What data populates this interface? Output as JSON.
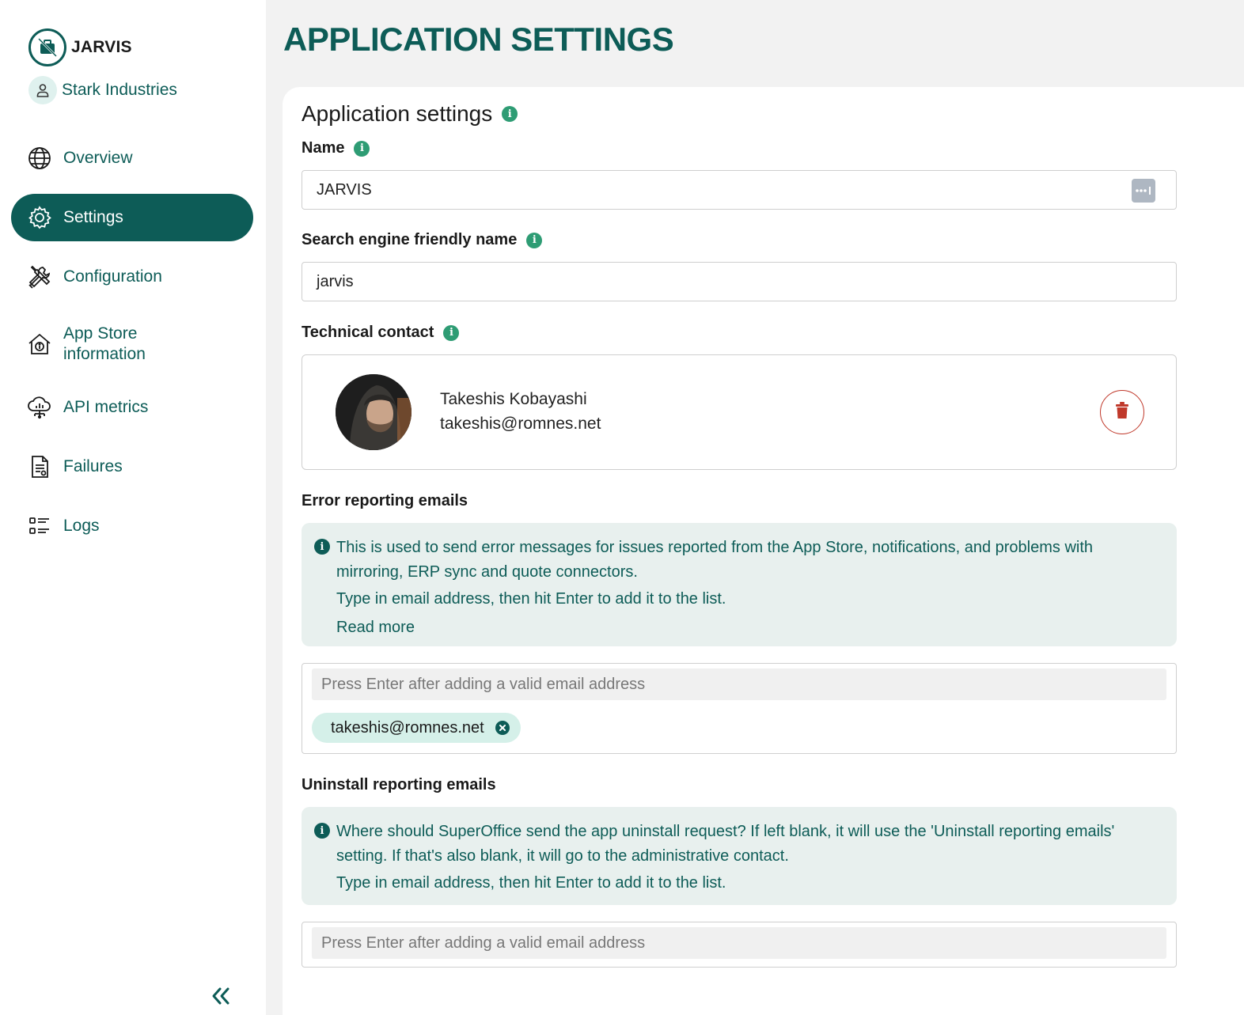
{
  "brand": {
    "name": "JARVIS"
  },
  "tenant": {
    "name": "Stark Industries"
  },
  "nav": {
    "items": [
      {
        "label": "Overview",
        "icon": "globe-icon"
      },
      {
        "label": "Settings",
        "icon": "gear-icon",
        "active": true
      },
      {
        "label": "Configuration",
        "icon": "tools-icon"
      },
      {
        "label": "App Store information",
        "icon": "store-info-icon"
      },
      {
        "label": "API metrics",
        "icon": "cloud-metrics-icon"
      },
      {
        "label": "Failures",
        "icon": "document-icon"
      },
      {
        "label": "Logs",
        "icon": "list-icon"
      }
    ]
  },
  "page": {
    "title": "APPLICATION SETTINGS"
  },
  "settings": {
    "section_title": "Application settings",
    "name": {
      "label": "Name",
      "value": "JARVIS"
    },
    "seo_name": {
      "label": "Search engine friendly name",
      "value": "jarvis"
    },
    "technical_contact": {
      "label": "Technical contact",
      "name": "Takeshis Kobayashi",
      "email": "takeshis@romnes.net"
    },
    "error_emails": {
      "label": "Error reporting emails",
      "info_line1": "This is used to send error messages for issues reported from the App Store, notifications, and problems with mirroring, ERP sync and quote connectors.",
      "info_line2": "Type in email address, then hit Enter to add it to the list.",
      "read_more": "Read more",
      "placeholder": "Press Enter after adding a valid email address",
      "chips": [
        "takeshis@romnes.net"
      ]
    },
    "uninstall_emails": {
      "label": "Uninstall reporting emails",
      "info_line1": "Where should SuperOffice send the app uninstall request? If left blank, it will use the 'Uninstall reporting emails' setting. If that's also blank, it will go to the administrative contact.",
      "info_line2": "Type in email address, then hit Enter to add it to the list.",
      "placeholder": "Press Enter after adding a valid email address"
    }
  },
  "colors": {
    "primary": "#0d5c57",
    "info_green": "#2e9c74",
    "panel_bg": "#e8f0ee",
    "chip_bg": "#d5f0e9",
    "danger": "#c0392b"
  }
}
